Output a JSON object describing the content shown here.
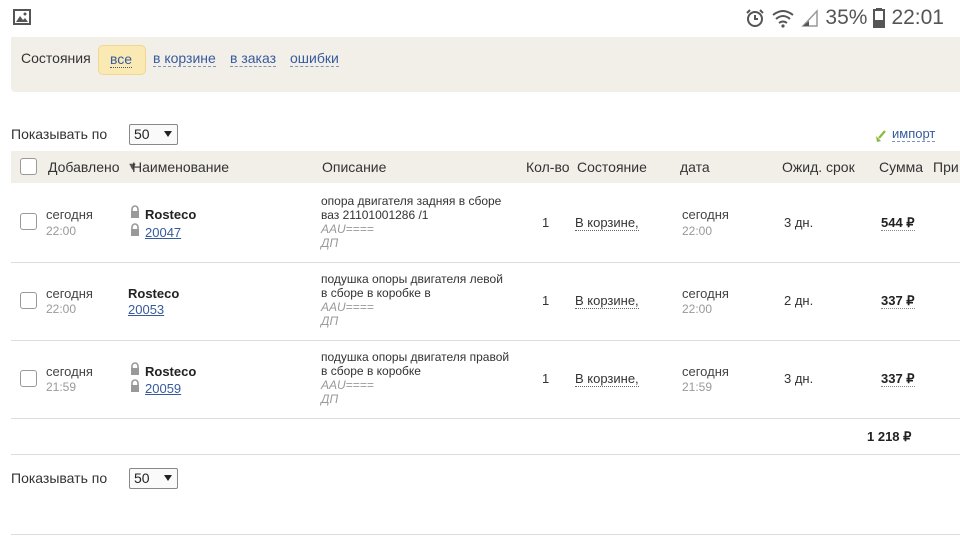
{
  "statusbar": {
    "battery_percent": "35%",
    "clock": "22:01",
    "icons": [
      "image-icon",
      "alarm-icon",
      "wifi-icon",
      "signal-icon",
      "battery-icon"
    ]
  },
  "filters": {
    "label": "Состояния",
    "options": [
      "все",
      "в корзине",
      "в заказ",
      "ошибки"
    ],
    "active": "все"
  },
  "pager_top": {
    "label": "Показывать по",
    "value": "50"
  },
  "pager_bottom": {
    "label": "Показывать по",
    "value": "50"
  },
  "import_link": "импорт",
  "table": {
    "columns": {
      "added": "Добавлено",
      "name": "Наименование",
      "description": "Описание",
      "qty": "Кол-во",
      "state": "Состояние",
      "date": "дата",
      "eta": "Ожид. срок",
      "sum": "Сумма",
      "note": "При"
    },
    "rows": [
      {
        "added_date": "сегодня",
        "added_time": "22:00",
        "supplier": "Rosteco",
        "code": "20047",
        "locked": true,
        "desc_lines": [
          "опора двигателя задняя в сборе",
          "ваз 21101001286 /1"
        ],
        "desc_sub1": "AAU====",
        "desc_sub2": "ДП",
        "qty": "1",
        "state": "В корзине,",
        "date": "сегодня",
        "date_time": "22:00",
        "eta": "3 дн.",
        "sum": "544 ₽"
      },
      {
        "added_date": "сегодня",
        "added_time": "22:00",
        "supplier": "Rosteco",
        "code": "20053",
        "locked": false,
        "desc_lines": [
          "подушка опоры двигателя левой",
          "в сборе в коробке в"
        ],
        "desc_sub1": "AAU====",
        "desc_sub2": "ДП",
        "qty": "1",
        "state": "В корзине,",
        "date": "сегодня",
        "date_time": "22:00",
        "eta": "2 дн.",
        "sum": "337 ₽"
      },
      {
        "added_date": "сегодня",
        "added_time": "21:59",
        "supplier": "Rosteco",
        "code": "20059",
        "locked": true,
        "desc_lines": [
          "подушка опоры двигателя правой",
          "в сборе в коробке"
        ],
        "desc_sub1": "AAU====",
        "desc_sub2": "ДП",
        "qty": "1",
        "state": "В корзине,",
        "date": "сегодня",
        "date_time": "21:59",
        "eta": "3 дн.",
        "sum": "337 ₽"
      }
    ],
    "total": "1 218 ₽"
  },
  "colors": {
    "accent_link": "#365a9c",
    "panel_bg": "#f2efe9",
    "chip_bg": "#fbe9b3"
  }
}
